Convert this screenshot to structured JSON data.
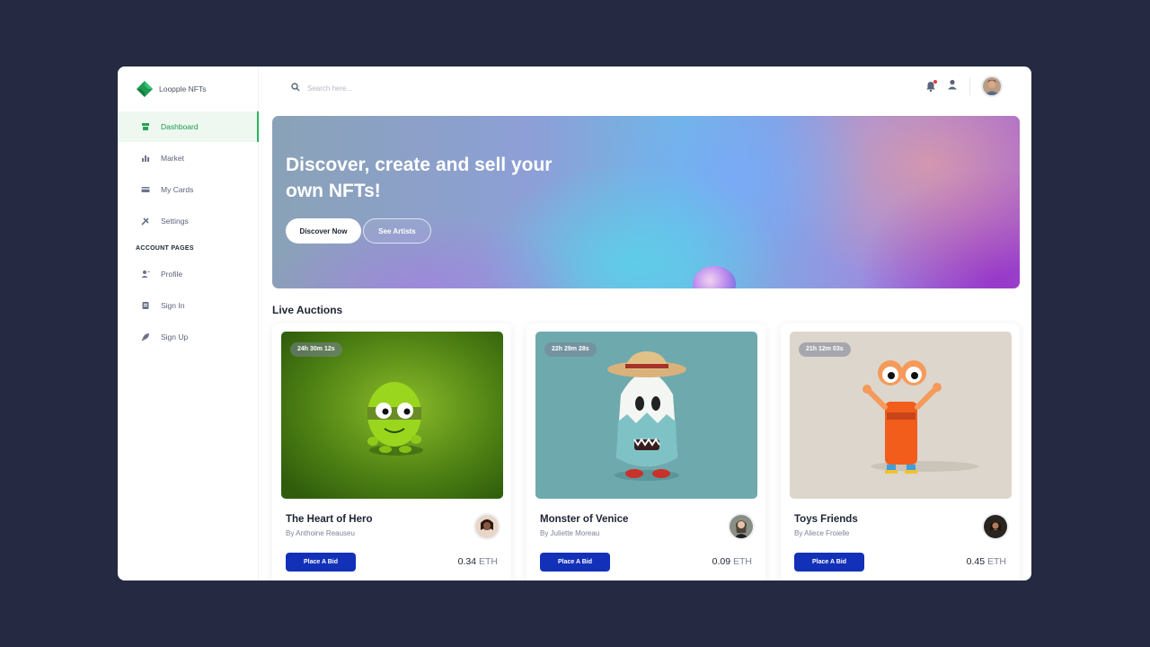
{
  "brand": {
    "name": "Loopple NFTs"
  },
  "sidebar": {
    "items": [
      {
        "label": "Dashboard",
        "icon": "store-icon",
        "active": true
      },
      {
        "label": "Market",
        "icon": "chart-bar-icon"
      },
      {
        "label": "My Cards",
        "icon": "credit-card-icon"
      },
      {
        "label": "Settings",
        "icon": "tools-icon"
      }
    ],
    "section_title": "ACCOUNT PAGES",
    "account_items": [
      {
        "label": "Profile",
        "icon": "user-icon"
      },
      {
        "label": "Sign In",
        "icon": "document-icon"
      },
      {
        "label": "Sign Up",
        "icon": "rocket-icon"
      }
    ]
  },
  "search": {
    "placeholder": "Search here..."
  },
  "hero": {
    "title": "Discover, create and sell your own NFTs!",
    "primary_button": "Discover Now",
    "secondary_button": "See Artists"
  },
  "auctions": {
    "heading": "Live Auctions",
    "bid_label": "Place A Bid",
    "cards": [
      {
        "timer": "24h 30m 12s",
        "title": "The Heart of Hero",
        "author": "By Anthoine Reauseu",
        "price": "0.34",
        "currency": "ETH"
      },
      {
        "timer": "22h 29m 28s",
        "title": "Monster of Venice",
        "author": "By Juliette Moreau",
        "price": "0.09",
        "currency": "ETH"
      },
      {
        "timer": "21h 12m 03s",
        "title": "Toys Friends",
        "author": "By Aliece Froielle",
        "price": "0.45",
        "currency": "ETH"
      }
    ]
  },
  "colors": {
    "background": "#252a42",
    "accent_green": "#2bb361",
    "bid_button": "#1331b8"
  }
}
